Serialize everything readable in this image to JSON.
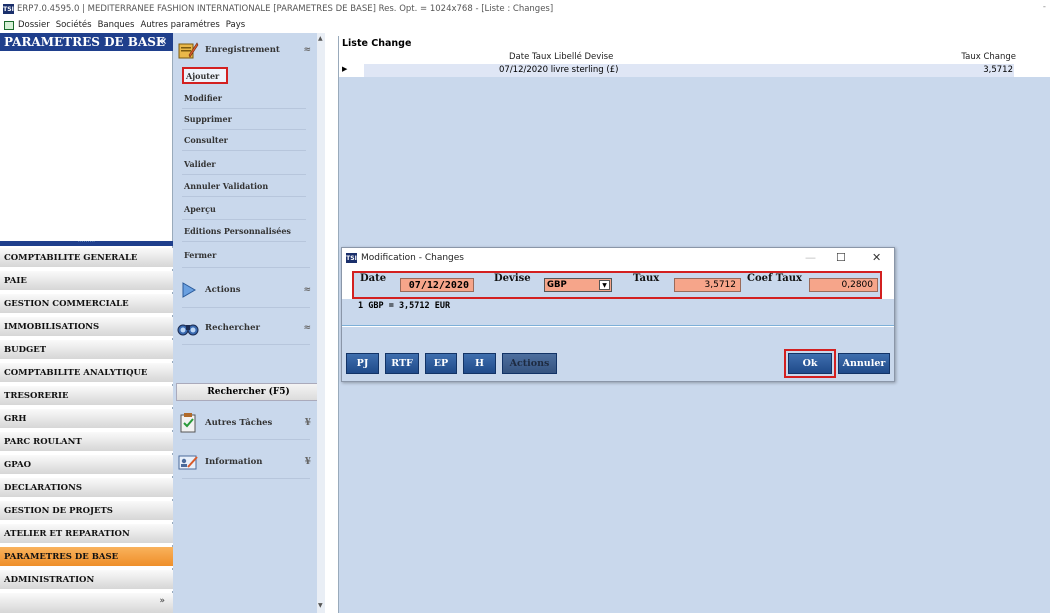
{
  "window": {
    "title": "ERP7.0.4595.0 | MEDITERRANEE FASHION INTERNATIONALE [PARAMETRES DE BASE] Res. Opt. = 1024x768 - [Liste : Changes]",
    "app_badge": "TSI"
  },
  "menu": [
    "Dossier",
    "Sociétés",
    "Banques",
    "Autres paramétres",
    "Pays"
  ],
  "left_panel": {
    "header": "PARAMETRES DE BASE",
    "collapse_glyph": "«",
    "modules": [
      {
        "label": "COMPTABILITE GENERALE",
        "active": false
      },
      {
        "label": "PAIE",
        "active": false
      },
      {
        "label": "GESTION COMMERCIALE",
        "active": false
      },
      {
        "label": "IMMOBILISATIONS",
        "active": false
      },
      {
        "label": "BUDGET",
        "active": false
      },
      {
        "label": "COMPTABILITE ANALYTIQUE",
        "active": false
      },
      {
        "label": "TRESORERIE",
        "active": false
      },
      {
        "label": "GRH",
        "active": false
      },
      {
        "label": "PARC ROULANT",
        "active": false
      },
      {
        "label": "GPAO",
        "active": false
      },
      {
        "label": "DECLARATIONS",
        "active": false
      },
      {
        "label": "GESTION DE PROJETS",
        "active": false
      },
      {
        "label": "ATELIER ET REPARATION",
        "active": false
      },
      {
        "label": "PARAMETRES DE BASE",
        "active": true
      },
      {
        "label": "ADMINISTRATION",
        "active": false
      }
    ],
    "footer_glyph": "»"
  },
  "task_pane": {
    "enregistrement": {
      "label": "Enregistrement",
      "items": [
        "Ajouter",
        "Modifier",
        "Supprimer",
        "Consulter",
        "Valider",
        "Annuler Validation",
        "Aperçu",
        "Editions Personnalisées",
        "Fermer"
      ]
    },
    "actions_label": "Actions",
    "rechercher_label": "Rechercher",
    "rechercher_button": "Rechercher (F5)",
    "autres_taches_label": "Autres Tâches",
    "information_label": "Information"
  },
  "list": {
    "title": "Liste Change",
    "col1_header": "Date Taux Libellé Devise",
    "col2_header": "Taux Change",
    "rows": [
      {
        "col1": "07/12/2020 livre sterling (£)",
        "col2": "3,5712"
      }
    ]
  },
  "dialog": {
    "title": "Modification - Changes",
    "date_label": "Date",
    "date_value": "07/12/2020",
    "devise_label": "Devise",
    "devise_value": "GBP",
    "taux_label": "Taux",
    "taux_value": "3,5712",
    "coef_label": "Coef Taux",
    "coef_value": "0,2800",
    "info_text": "1 GBP = 3,5712 EUR",
    "buttons": {
      "pj": "PJ",
      "rtf": "RTF",
      "ep": "EP",
      "h": "H",
      "actions": "Actions",
      "ok": "Ok",
      "annuler": "Annuler"
    }
  },
  "colors": {
    "navy": "#1f3f8c",
    "panel": "#c9d8ec",
    "active_module": "#ef8f2a",
    "field": "#f6a58a",
    "highlight": "#d32020"
  }
}
